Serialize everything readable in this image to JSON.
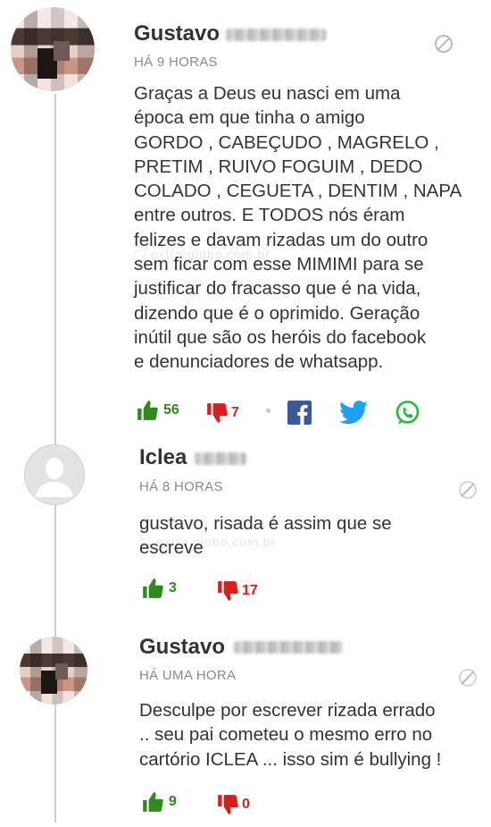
{
  "comments": [
    {
      "author": "Gustavo",
      "time": "HÁ 9 HORAS",
      "lines": [
        "Graças a Deus eu nasci em uma",
        "época em que tinha o amigo",
        "GORDO , CABEÇUDO , MAGRELO ,",
        "PRETIM , RUIVO FOGUIM , DEDO",
        "COLADO , CEGUETA , DENTIM , NAPA",
        "entre outros. E TODOS nós éram",
        "felizes e davam rizadas um do outro",
        "sem ficar com esse MIMIMI para se",
        "justificar do fracasso que é na vida,",
        "dizendo que é o oprimido. Geração",
        "inútil que são os heróis do facebook",
        "e denunciadores de whatsapp."
      ],
      "likes": "56",
      "dislikes": "7"
    },
    {
      "author": "Iclea",
      "time": "HÁ 8 HORAS",
      "lines": [
        "gustavo, risada é assim que se",
        "escreve"
      ],
      "likes": "3",
      "dislikes": "17"
    },
    {
      "author": "Gustavo",
      "time": "HÁ UMA HORA",
      "lines": [
        "Desculpe por escrever rizada errado",
        ".. seu pai cometeu o mesmo erro no",
        "cartório ICLEA ... isso sim é bullying !"
      ],
      "likes": "9",
      "dislikes": "0"
    }
  ],
  "icons": {
    "like": "thumbs-up-icon",
    "dislike": "thumbs-down-icon",
    "report": "flag-icon",
    "facebook": "facebook-icon",
    "twitter": "twitter-icon",
    "whatsapp": "whatsapp-icon"
  },
  "colors": {
    "like": "#2f8a1e",
    "dislike": "#d81f1f",
    "facebook": "#3b5998",
    "twitter": "#1da1f2",
    "whatsapp": "#2bb741"
  }
}
